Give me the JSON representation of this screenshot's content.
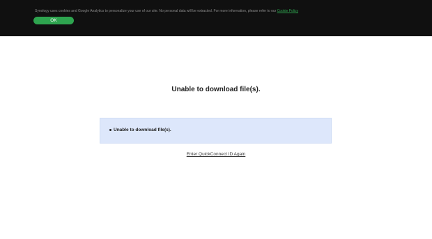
{
  "cookie_banner": {
    "text": "Synology uses cookies and Google Analytics to personalize your use of our site. No personal data will be extracted. For more information, please refer to our ",
    "link_label": "Cookie Policy",
    "ok_label": "OK",
    "accent_color": "#2ea44f"
  },
  "main": {
    "title": "Unable to download file(s).",
    "messages": [
      "Unable to download file(s)."
    ],
    "retry_link": "Enter QuickConnect ID Again",
    "message_box_color": "#dde7fb"
  }
}
